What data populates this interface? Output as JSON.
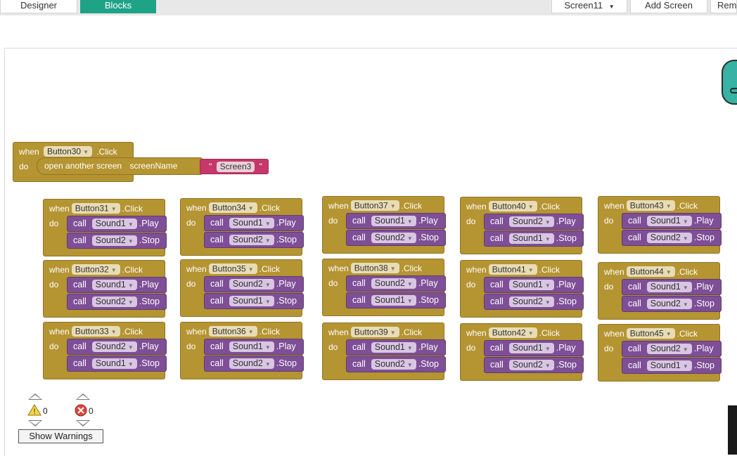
{
  "toolbar": {
    "designer": "Designer",
    "blocks": "Blocks",
    "screen": "Screen11",
    "add_screen": "Add Screen",
    "remove_screen": "Remo",
    "dropdown_icon": "caret-down"
  },
  "labels": {
    "when": "when",
    "do": "do",
    "call": "call",
    "click": ".Click",
    "play": ".Play",
    "stop": ".Stop",
    "open_screen": "open another screen",
    "screen_name": "screenName",
    "quote": "\""
  },
  "screen_block": {
    "button": "Button30",
    "screen_value": "Screen3"
  },
  "event_blocks": [
    {
      "button": "Button31",
      "first_sound": "Sound1",
      "second_sound": "Sound2"
    },
    {
      "button": "Button32",
      "first_sound": "Sound1",
      "second_sound": "Sound2"
    },
    {
      "button": "Button33",
      "first_sound": "Sound2",
      "second_sound": "Sound1"
    },
    {
      "button": "Button34",
      "first_sound": "Sound1",
      "second_sound": "Sound2"
    },
    {
      "button": "Button35",
      "first_sound": "Sound2",
      "second_sound": "Sound1"
    },
    {
      "button": "Button36",
      "first_sound": "Sound1",
      "second_sound": "Sound2"
    },
    {
      "button": "Button37",
      "first_sound": "Sound1",
      "second_sound": "Sound2"
    },
    {
      "button": "Button38",
      "first_sound": "Sound2",
      "second_sound": "Sound1"
    },
    {
      "button": "Button39",
      "first_sound": "Sound1",
      "second_sound": "Sound2"
    },
    {
      "button": "Button40",
      "first_sound": "Sound2",
      "second_sound": "Sound1"
    },
    {
      "button": "Button41",
      "first_sound": "Sound1",
      "second_sound": "Sound2"
    },
    {
      "button": "Button42",
      "first_sound": "Sound1",
      "second_sound": "Sound2"
    },
    {
      "button": "Button43",
      "first_sound": "Sound1",
      "second_sound": "Sound2"
    },
    {
      "button": "Button44",
      "first_sound": "Sound1",
      "second_sound": "Sound2"
    },
    {
      "button": "Button45",
      "first_sound": "Sound2",
      "second_sound": "Sound1"
    }
  ],
  "warnings": {
    "warning_count": "0",
    "error_count": "0",
    "show_button": "Show Warnings"
  },
  "colors": {
    "event_block": "#b59432",
    "call_block": "#7e4f96",
    "text_block": "#c63869",
    "active_tab": "#1fa387",
    "backpack": "#36b3a3"
  }
}
